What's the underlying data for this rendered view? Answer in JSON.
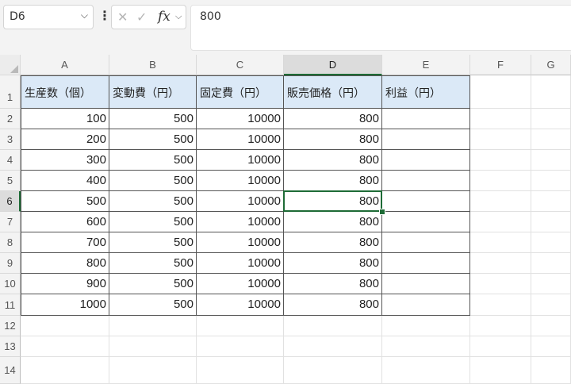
{
  "formula_bar": {
    "name_box": "D6",
    "fx_label": "fx",
    "formula_value": "800"
  },
  "columns": [
    "A",
    "B",
    "C",
    "D",
    "E",
    "F",
    "G"
  ],
  "selected_column": "D",
  "rows": [
    "1",
    "2",
    "3",
    "4",
    "5",
    "6",
    "7",
    "8",
    "9",
    "10",
    "11",
    "12",
    "13",
    "14"
  ],
  "selected_row": "6",
  "table": {
    "headers": [
      "生産数（個）",
      "変動費（円）",
      "固定費（円）",
      "販売価格（円）",
      "利益（円）"
    ],
    "data": [
      [
        "100",
        "500",
        "10000",
        "800",
        ""
      ],
      [
        "200",
        "500",
        "10000",
        "800",
        ""
      ],
      [
        "300",
        "500",
        "10000",
        "800",
        ""
      ],
      [
        "400",
        "500",
        "10000",
        "800",
        ""
      ],
      [
        "500",
        "500",
        "10000",
        "800",
        ""
      ],
      [
        "600",
        "500",
        "10000",
        "800",
        ""
      ],
      [
        "700",
        "500",
        "10000",
        "800",
        ""
      ],
      [
        "800",
        "500",
        "10000",
        "800",
        ""
      ],
      [
        "900",
        "500",
        "10000",
        "800",
        ""
      ],
      [
        "1000",
        "500",
        "10000",
        "800",
        ""
      ]
    ]
  },
  "colors": {
    "accent": "#1e6b36",
    "header_fill": "#dbe9f7"
  }
}
